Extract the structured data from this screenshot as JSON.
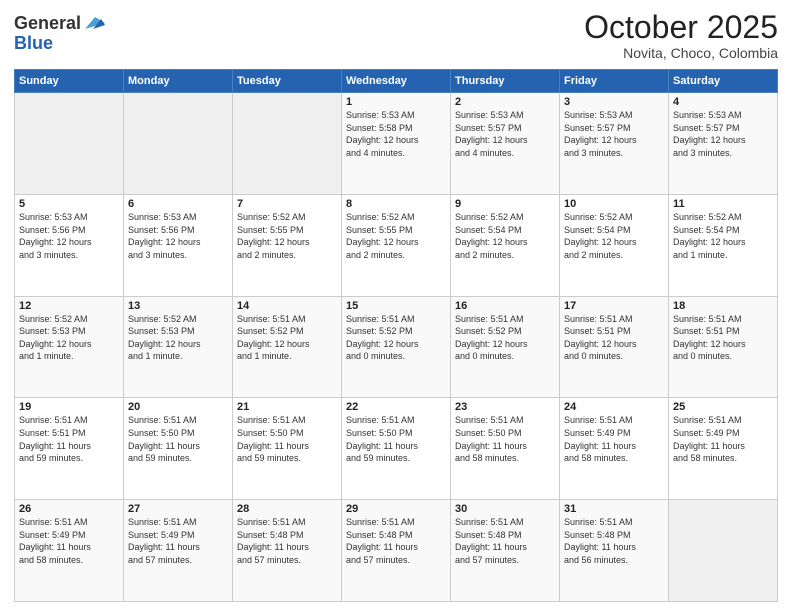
{
  "header": {
    "logo_line1": "General",
    "logo_line2": "Blue",
    "title": "October 2025",
    "subtitle": "Novita, Choco, Colombia"
  },
  "days_of_week": [
    "Sunday",
    "Monday",
    "Tuesday",
    "Wednesday",
    "Thursday",
    "Friday",
    "Saturday"
  ],
  "weeks": [
    [
      {
        "day": "",
        "info": ""
      },
      {
        "day": "",
        "info": ""
      },
      {
        "day": "",
        "info": ""
      },
      {
        "day": "1",
        "info": "Sunrise: 5:53 AM\nSunset: 5:58 PM\nDaylight: 12 hours\nand 4 minutes."
      },
      {
        "day": "2",
        "info": "Sunrise: 5:53 AM\nSunset: 5:57 PM\nDaylight: 12 hours\nand 4 minutes."
      },
      {
        "day": "3",
        "info": "Sunrise: 5:53 AM\nSunset: 5:57 PM\nDaylight: 12 hours\nand 3 minutes."
      },
      {
        "day": "4",
        "info": "Sunrise: 5:53 AM\nSunset: 5:57 PM\nDaylight: 12 hours\nand 3 minutes."
      }
    ],
    [
      {
        "day": "5",
        "info": "Sunrise: 5:53 AM\nSunset: 5:56 PM\nDaylight: 12 hours\nand 3 minutes."
      },
      {
        "day": "6",
        "info": "Sunrise: 5:53 AM\nSunset: 5:56 PM\nDaylight: 12 hours\nand 3 minutes."
      },
      {
        "day": "7",
        "info": "Sunrise: 5:52 AM\nSunset: 5:55 PM\nDaylight: 12 hours\nand 2 minutes."
      },
      {
        "day": "8",
        "info": "Sunrise: 5:52 AM\nSunset: 5:55 PM\nDaylight: 12 hours\nand 2 minutes."
      },
      {
        "day": "9",
        "info": "Sunrise: 5:52 AM\nSunset: 5:54 PM\nDaylight: 12 hours\nand 2 minutes."
      },
      {
        "day": "10",
        "info": "Sunrise: 5:52 AM\nSunset: 5:54 PM\nDaylight: 12 hours\nand 2 minutes."
      },
      {
        "day": "11",
        "info": "Sunrise: 5:52 AM\nSunset: 5:54 PM\nDaylight: 12 hours\nand 1 minute."
      }
    ],
    [
      {
        "day": "12",
        "info": "Sunrise: 5:52 AM\nSunset: 5:53 PM\nDaylight: 12 hours\nand 1 minute."
      },
      {
        "day": "13",
        "info": "Sunrise: 5:52 AM\nSunset: 5:53 PM\nDaylight: 12 hours\nand 1 minute."
      },
      {
        "day": "14",
        "info": "Sunrise: 5:51 AM\nSunset: 5:52 PM\nDaylight: 12 hours\nand 1 minute."
      },
      {
        "day": "15",
        "info": "Sunrise: 5:51 AM\nSunset: 5:52 PM\nDaylight: 12 hours\nand 0 minutes."
      },
      {
        "day": "16",
        "info": "Sunrise: 5:51 AM\nSunset: 5:52 PM\nDaylight: 12 hours\nand 0 minutes."
      },
      {
        "day": "17",
        "info": "Sunrise: 5:51 AM\nSunset: 5:51 PM\nDaylight: 12 hours\nand 0 minutes."
      },
      {
        "day": "18",
        "info": "Sunrise: 5:51 AM\nSunset: 5:51 PM\nDaylight: 12 hours\nand 0 minutes."
      }
    ],
    [
      {
        "day": "19",
        "info": "Sunrise: 5:51 AM\nSunset: 5:51 PM\nDaylight: 11 hours\nand 59 minutes."
      },
      {
        "day": "20",
        "info": "Sunrise: 5:51 AM\nSunset: 5:50 PM\nDaylight: 11 hours\nand 59 minutes."
      },
      {
        "day": "21",
        "info": "Sunrise: 5:51 AM\nSunset: 5:50 PM\nDaylight: 11 hours\nand 59 minutes."
      },
      {
        "day": "22",
        "info": "Sunrise: 5:51 AM\nSunset: 5:50 PM\nDaylight: 11 hours\nand 59 minutes."
      },
      {
        "day": "23",
        "info": "Sunrise: 5:51 AM\nSunset: 5:50 PM\nDaylight: 11 hours\nand 58 minutes."
      },
      {
        "day": "24",
        "info": "Sunrise: 5:51 AM\nSunset: 5:49 PM\nDaylight: 11 hours\nand 58 minutes."
      },
      {
        "day": "25",
        "info": "Sunrise: 5:51 AM\nSunset: 5:49 PM\nDaylight: 11 hours\nand 58 minutes."
      }
    ],
    [
      {
        "day": "26",
        "info": "Sunrise: 5:51 AM\nSunset: 5:49 PM\nDaylight: 11 hours\nand 58 minutes."
      },
      {
        "day": "27",
        "info": "Sunrise: 5:51 AM\nSunset: 5:49 PM\nDaylight: 11 hours\nand 57 minutes."
      },
      {
        "day": "28",
        "info": "Sunrise: 5:51 AM\nSunset: 5:48 PM\nDaylight: 11 hours\nand 57 minutes."
      },
      {
        "day": "29",
        "info": "Sunrise: 5:51 AM\nSunset: 5:48 PM\nDaylight: 11 hours\nand 57 minutes."
      },
      {
        "day": "30",
        "info": "Sunrise: 5:51 AM\nSunset: 5:48 PM\nDaylight: 11 hours\nand 57 minutes."
      },
      {
        "day": "31",
        "info": "Sunrise: 5:51 AM\nSunset: 5:48 PM\nDaylight: 11 hours\nand 56 minutes."
      },
      {
        "day": "",
        "info": ""
      }
    ]
  ]
}
